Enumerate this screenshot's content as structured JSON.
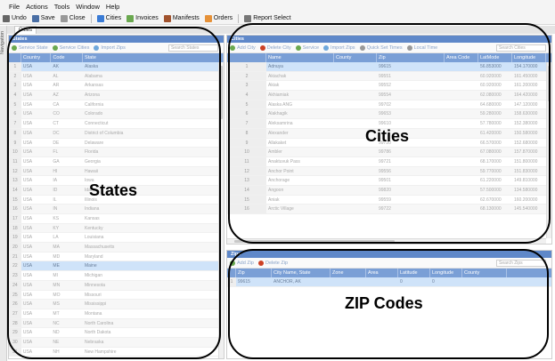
{
  "menu": [
    "File",
    "Actions",
    "Tools",
    "Window",
    "Help"
  ],
  "toolbar": [
    {
      "label": "Undo",
      "color": "#666666"
    },
    {
      "label": "Save",
      "color": "#4a6fa5"
    },
    {
      "label": "Close",
      "color": "#999999"
    },
    {
      "label": "Cities",
      "color": "#3a7bd5"
    },
    {
      "label": "Invoices",
      "color": "#6aa84f"
    },
    {
      "label": "Manifests",
      "color": "#a0522d"
    },
    {
      "label": "Orders",
      "color": "#e69138"
    },
    {
      "label": "Report Select",
      "color": "#777777"
    }
  ],
  "main_tab": "Cities",
  "navigation_label": "Navigation",
  "states": {
    "header": "States",
    "actions": [
      "Service State",
      "Service Cities",
      "Import Zips"
    ],
    "search_placeholder": "Search States",
    "columns": [
      "Country",
      "Code",
      "State"
    ],
    "rows": [
      [
        "USA",
        "AK",
        "Alaska"
      ],
      [
        "USA",
        "AL",
        "Alabama"
      ],
      [
        "USA",
        "AR",
        "Arkansas"
      ],
      [
        "USA",
        "AZ",
        "Arizona"
      ],
      [
        "USA",
        "CA",
        "California"
      ],
      [
        "USA",
        "CO",
        "Colorado"
      ],
      [
        "USA",
        "CT",
        "Connecticut"
      ],
      [
        "USA",
        "DC",
        "District of Columbia"
      ],
      [
        "USA",
        "DE",
        "Delaware"
      ],
      [
        "USA",
        "FL",
        "Florida"
      ],
      [
        "USA",
        "GA",
        "Georgia"
      ],
      [
        "USA",
        "HI",
        "Hawaii"
      ],
      [
        "USA",
        "IA",
        "Iowa"
      ],
      [
        "USA",
        "ID",
        "Idaho"
      ],
      [
        "USA",
        "IL",
        "Illinois"
      ],
      [
        "USA",
        "IN",
        "Indiana"
      ],
      [
        "USA",
        "KS",
        "Kansas"
      ],
      [
        "USA",
        "KY",
        "Kentucky"
      ],
      [
        "USA",
        "LA",
        "Louisiana"
      ],
      [
        "USA",
        "MA",
        "Massachusetts"
      ],
      [
        "USA",
        "MD",
        "Maryland"
      ],
      [
        "USA",
        "ME",
        "Maine"
      ],
      [
        "USA",
        "MI",
        "Michigan"
      ],
      [
        "USA",
        "MN",
        "Minnesota"
      ],
      [
        "USA",
        "MO",
        "Missouri"
      ],
      [
        "USA",
        "MS",
        "Mississippi"
      ],
      [
        "USA",
        "MT",
        "Montana"
      ],
      [
        "USA",
        "NC",
        "North Carolina"
      ],
      [
        "USA",
        "ND",
        "North Dakota"
      ],
      [
        "USA",
        "NE",
        "Nebraska"
      ],
      [
        "USA",
        "NH",
        "New Hampshire"
      ]
    ],
    "selected_rows": [
      0,
      21
    ]
  },
  "cities": {
    "header": "Cities",
    "actions": [
      "Add City",
      "Delete City",
      "Service",
      "Import Zips",
      "Quick Set Times",
      "Local Time"
    ],
    "search_placeholder": "Search Cities",
    "columns": [
      "Name",
      "County",
      "Zip",
      "Area Code",
      "LatMode",
      "Longitude"
    ],
    "rows": [
      [
        "Adnuya",
        "",
        "99615",
        "",
        "56.853000",
        "154.170000"
      ],
      [
        "Akiachak",
        "",
        "99551",
        "",
        "60.920000",
        "161.450000"
      ],
      [
        "Akiak",
        "",
        "99552",
        "",
        "60.920000",
        "161.200000"
      ],
      [
        "Akhiamiak",
        "",
        "99554",
        "",
        "62.080000",
        "164.420000"
      ],
      [
        "Alaska ANG",
        "",
        "99702",
        "",
        "64.680000",
        "147.120000"
      ],
      [
        "Alakhagik",
        "",
        "99653",
        "",
        "59.280000",
        "158.630000"
      ],
      [
        "Aleksamrina",
        "",
        "99610",
        "",
        "57.780000",
        "152.380000"
      ],
      [
        "Alexander",
        "",
        "",
        "",
        "61.420000",
        "150.580000"
      ],
      [
        "Allakaket",
        "",
        "99720",
        "",
        "66.570000",
        "152.680000"
      ],
      [
        "Ambler",
        "",
        "99786",
        "",
        "67.080000",
        "157.870000"
      ],
      [
        "Anaktuvuk Pass",
        "",
        "99721",
        "",
        "68.170000",
        "151.800000"
      ],
      [
        "Anchor Point",
        "",
        "99556",
        "",
        "59.770000",
        "151.830000"
      ],
      [
        "Anchorage",
        "",
        "99501",
        "",
        "61.220000",
        "149.810000"
      ],
      [
        "Angoon",
        "",
        "99820",
        "",
        "57.500000",
        "134.580000"
      ],
      [
        "Aniak",
        "",
        "99559",
        "",
        "62.670000",
        "160.200000"
      ],
      [
        "Arctic Village",
        "",
        "99722",
        "",
        "68.130000",
        "145.540000"
      ]
    ],
    "selected_rows": [
      0
    ]
  },
  "zips": {
    "header": "Zips",
    "actions": [
      "Add Zip",
      "Delete Zip"
    ],
    "search_placeholder": "Search Zips",
    "columns": [
      "Zip",
      "City Name, State",
      "Zone",
      "Area",
      "Latitude",
      "Longitude",
      "County"
    ],
    "rows": [
      [
        "99615",
        "ANCHOR, AK",
        "",
        "",
        "0",
        "0",
        ""
      ]
    ],
    "selected_rows": [
      0
    ]
  },
  "annotations": {
    "states": "States",
    "cities": "Cities",
    "zips": "ZIP Codes"
  }
}
